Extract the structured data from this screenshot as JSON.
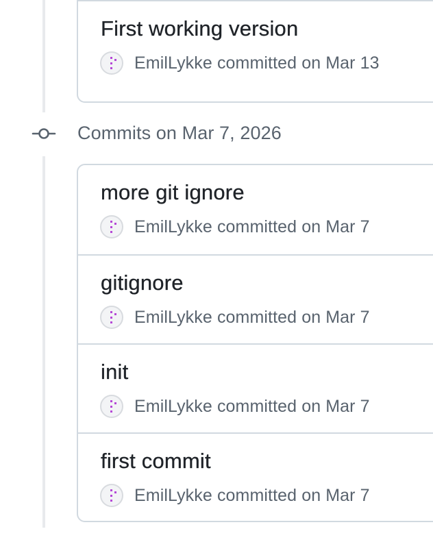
{
  "groups": [
    {
      "commits": [
        {
          "title": "First working version",
          "author": "EmilLykke",
          "action": "committed",
          "date": "on Mar 13"
        }
      ]
    },
    {
      "header": "Commits on Mar 7, 2026",
      "commits": [
        {
          "title": "more git ignore",
          "author": "EmilLykke",
          "action": "committed",
          "date": "on Mar 7"
        },
        {
          "title": "gitignore",
          "author": "EmilLykke",
          "action": "committed",
          "date": "on Mar 7"
        },
        {
          "title": "init",
          "author": "EmilLykke",
          "action": "committed",
          "date": "on Mar 7"
        },
        {
          "title": "first commit",
          "author": "EmilLykke",
          "action": "committed",
          "date": "on Mar 7"
        }
      ]
    }
  ],
  "colors": {
    "avatar_accent": "#b548d6",
    "timeline": "#e8eaed",
    "border": "#d1d9e0",
    "muted_text": "#59636e"
  },
  "icons": {
    "group_node": "git-commit-icon",
    "avatar": "identicon-avatar"
  }
}
